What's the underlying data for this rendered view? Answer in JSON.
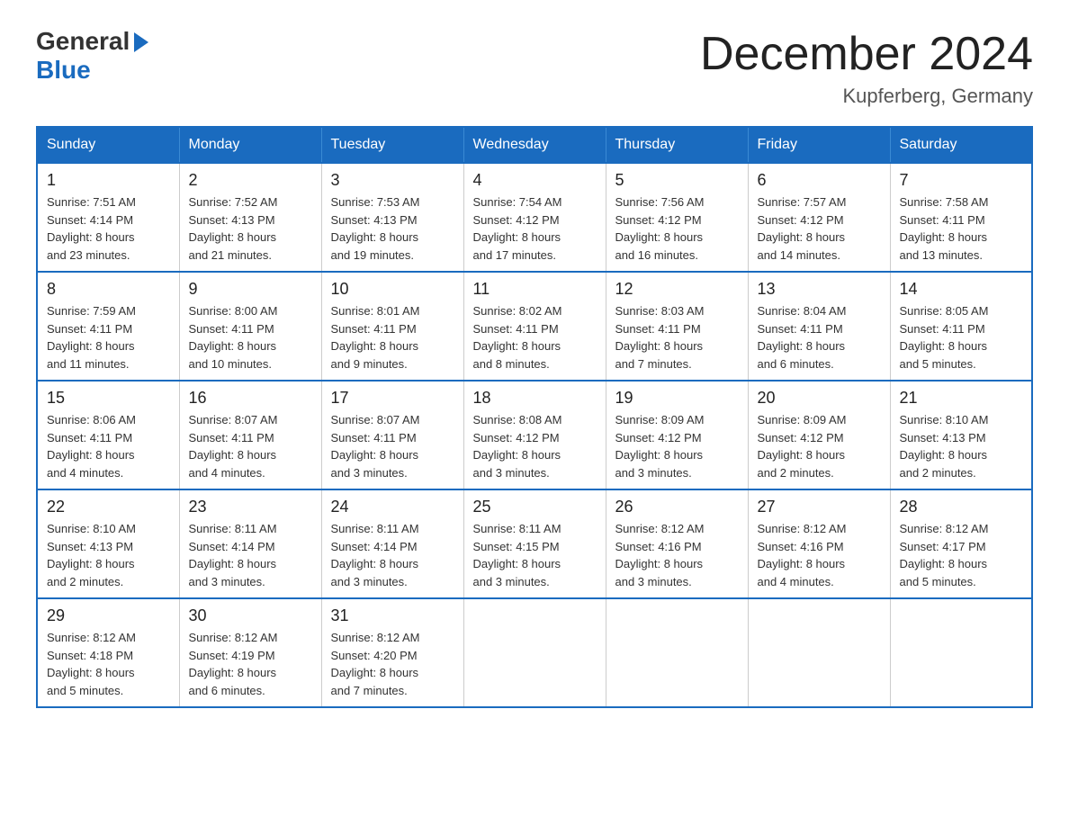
{
  "logo": {
    "general": "General",
    "blue": "Blue"
  },
  "header": {
    "month": "December 2024",
    "location": "Kupferberg, Germany"
  },
  "days_of_week": [
    "Sunday",
    "Monday",
    "Tuesday",
    "Wednesday",
    "Thursday",
    "Friday",
    "Saturday"
  ],
  "weeks": [
    [
      {
        "day": "1",
        "sunrise": "7:51 AM",
        "sunset": "4:14 PM",
        "daylight": "8 hours and 23 minutes."
      },
      {
        "day": "2",
        "sunrise": "7:52 AM",
        "sunset": "4:13 PM",
        "daylight": "8 hours and 21 minutes."
      },
      {
        "day": "3",
        "sunrise": "7:53 AM",
        "sunset": "4:13 PM",
        "daylight": "8 hours and 19 minutes."
      },
      {
        "day": "4",
        "sunrise": "7:54 AM",
        "sunset": "4:12 PM",
        "daylight": "8 hours and 17 minutes."
      },
      {
        "day": "5",
        "sunrise": "7:56 AM",
        "sunset": "4:12 PM",
        "daylight": "8 hours and 16 minutes."
      },
      {
        "day": "6",
        "sunrise": "7:57 AM",
        "sunset": "4:12 PM",
        "daylight": "8 hours and 14 minutes."
      },
      {
        "day": "7",
        "sunrise": "7:58 AM",
        "sunset": "4:11 PM",
        "daylight": "8 hours and 13 minutes."
      }
    ],
    [
      {
        "day": "8",
        "sunrise": "7:59 AM",
        "sunset": "4:11 PM",
        "daylight": "8 hours and 11 minutes."
      },
      {
        "day": "9",
        "sunrise": "8:00 AM",
        "sunset": "4:11 PM",
        "daylight": "8 hours and 10 minutes."
      },
      {
        "day": "10",
        "sunrise": "8:01 AM",
        "sunset": "4:11 PM",
        "daylight": "8 hours and 9 minutes."
      },
      {
        "day": "11",
        "sunrise": "8:02 AM",
        "sunset": "4:11 PM",
        "daylight": "8 hours and 8 minutes."
      },
      {
        "day": "12",
        "sunrise": "8:03 AM",
        "sunset": "4:11 PM",
        "daylight": "8 hours and 7 minutes."
      },
      {
        "day": "13",
        "sunrise": "8:04 AM",
        "sunset": "4:11 PM",
        "daylight": "8 hours and 6 minutes."
      },
      {
        "day": "14",
        "sunrise": "8:05 AM",
        "sunset": "4:11 PM",
        "daylight": "8 hours and 5 minutes."
      }
    ],
    [
      {
        "day": "15",
        "sunrise": "8:06 AM",
        "sunset": "4:11 PM",
        "daylight": "8 hours and 4 minutes."
      },
      {
        "day": "16",
        "sunrise": "8:07 AM",
        "sunset": "4:11 PM",
        "daylight": "8 hours and 4 minutes."
      },
      {
        "day": "17",
        "sunrise": "8:07 AM",
        "sunset": "4:11 PM",
        "daylight": "8 hours and 3 minutes."
      },
      {
        "day": "18",
        "sunrise": "8:08 AM",
        "sunset": "4:12 PM",
        "daylight": "8 hours and 3 minutes."
      },
      {
        "day": "19",
        "sunrise": "8:09 AM",
        "sunset": "4:12 PM",
        "daylight": "8 hours and 3 minutes."
      },
      {
        "day": "20",
        "sunrise": "8:09 AM",
        "sunset": "4:12 PM",
        "daylight": "8 hours and 2 minutes."
      },
      {
        "day": "21",
        "sunrise": "8:10 AM",
        "sunset": "4:13 PM",
        "daylight": "8 hours and 2 minutes."
      }
    ],
    [
      {
        "day": "22",
        "sunrise": "8:10 AM",
        "sunset": "4:13 PM",
        "daylight": "8 hours and 2 minutes."
      },
      {
        "day": "23",
        "sunrise": "8:11 AM",
        "sunset": "4:14 PM",
        "daylight": "8 hours and 3 minutes."
      },
      {
        "day": "24",
        "sunrise": "8:11 AM",
        "sunset": "4:14 PM",
        "daylight": "8 hours and 3 minutes."
      },
      {
        "day": "25",
        "sunrise": "8:11 AM",
        "sunset": "4:15 PM",
        "daylight": "8 hours and 3 minutes."
      },
      {
        "day": "26",
        "sunrise": "8:12 AM",
        "sunset": "4:16 PM",
        "daylight": "8 hours and 3 minutes."
      },
      {
        "day": "27",
        "sunrise": "8:12 AM",
        "sunset": "4:16 PM",
        "daylight": "8 hours and 4 minutes."
      },
      {
        "day": "28",
        "sunrise": "8:12 AM",
        "sunset": "4:17 PM",
        "daylight": "8 hours and 5 minutes."
      }
    ],
    [
      {
        "day": "29",
        "sunrise": "8:12 AM",
        "sunset": "4:18 PM",
        "daylight": "8 hours and 5 minutes."
      },
      {
        "day": "30",
        "sunrise": "8:12 AM",
        "sunset": "4:19 PM",
        "daylight": "8 hours and 6 minutes."
      },
      {
        "day": "31",
        "sunrise": "8:12 AM",
        "sunset": "4:20 PM",
        "daylight": "8 hours and 7 minutes."
      },
      null,
      null,
      null,
      null
    ]
  ],
  "labels": {
    "sunrise": "Sunrise:",
    "sunset": "Sunset:",
    "daylight": "Daylight:"
  }
}
